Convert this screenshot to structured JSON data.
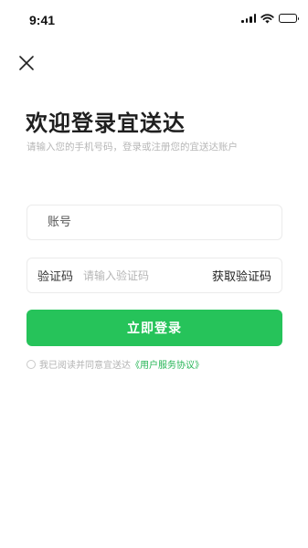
{
  "status_bar": {
    "time": "9:41",
    "icons": [
      "signal-icon",
      "wifi-icon",
      "battery-icon"
    ]
  },
  "nav": {
    "close_icon": "close-icon"
  },
  "header": {
    "title": "欢迎登录宜送达",
    "subtitle": "请输入您的手机号码，登录或注册您的宜送达账户"
  },
  "form": {
    "account_placeholder": "账号",
    "code_label": "验证码",
    "code_placeholder": "请输入验证码",
    "get_code_label": "获取验证码",
    "login_label": "立即登录"
  },
  "agreement": {
    "prefix": "我已阅读并同意宜送达",
    "link_text": "《用户服务协议》",
    "checked": false
  },
  "colors": {
    "accent": "#26c35a",
    "link": "#26b556",
    "placeholder": "#b5b5b5",
    "border": "#ebebeb"
  }
}
